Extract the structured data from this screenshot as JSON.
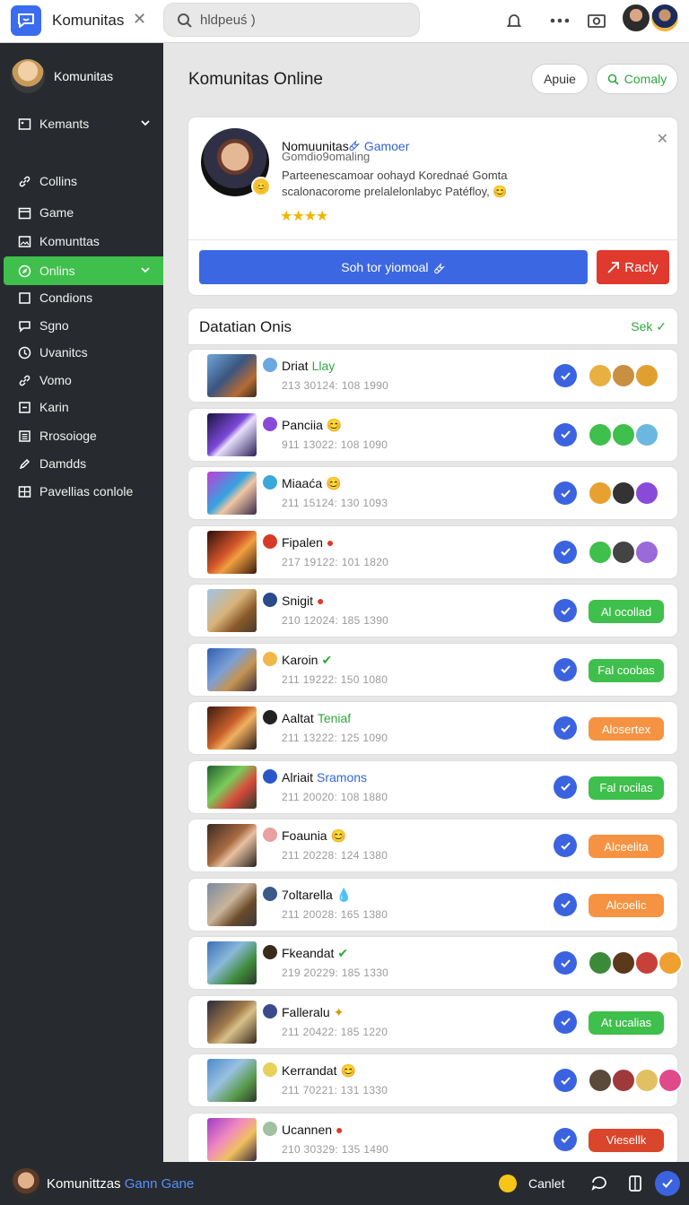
{
  "app": {
    "title": "Komunitas"
  },
  "search": {
    "value": "hldpeuś )"
  },
  "sidebar": {
    "profile_name": "Komunitas",
    "section_label": "Kemants",
    "items": [
      {
        "label": "Collins",
        "icon": "link-icon"
      },
      {
        "label": "Game",
        "icon": "calendar-icon"
      },
      {
        "label": "Komunttas",
        "icon": "image-icon"
      },
      {
        "label": "Onlins",
        "icon": "compass-icon",
        "active": true
      },
      {
        "label": "Condions",
        "icon": "square-icon"
      },
      {
        "label": "Sgno",
        "icon": "chat-icon"
      },
      {
        "label": "Uvanitcs",
        "icon": "clock-icon"
      },
      {
        "label": "Vomo",
        "icon": "link-icon"
      },
      {
        "label": "Karin",
        "icon": "minus-square-icon"
      },
      {
        "label": "Rrosoioge",
        "icon": "list-icon"
      },
      {
        "label": "Damdds",
        "icon": "pencil-icon"
      },
      {
        "label": "Pavellias conlole",
        "icon": "grid-icon"
      }
    ]
  },
  "main": {
    "title": "Komunitas Online",
    "btn_secondary": "Apuie",
    "btn_primary": "Comaly"
  },
  "hero": {
    "name": "Nomuunitas",
    "name_tag": "Gamoer",
    "subtitle": "Gomdio9omaling",
    "desc_line1": "Parteenescamoar oohayd Korednaé Gomta",
    "desc_line2": "scalonacorome prelalelonlabyc Patéfloy,",
    "stars": "★★★★",
    "primary_action": "Soh tor yiomoal",
    "secondary_action": "Racly"
  },
  "list": {
    "title": "Datatian Onis",
    "action": "Sek",
    "rows": [
      {
        "name": "Driat",
        "tag": "Llay",
        "tag_color": "#2fa83e",
        "meta": "213 30124: 108 1990",
        "pill": null,
        "pill_color": null
      },
      {
        "name": "Panciia",
        "tag": "😊",
        "tag_color": "#d49a00",
        "meta": "911 13022: 108 1090",
        "pill": null,
        "pill_color": null
      },
      {
        "name": "Miaaća",
        "tag": "😊",
        "tag_color": "#d49a00",
        "meta": "211 15124: 130 1093",
        "pill": null,
        "pill_color": null
      },
      {
        "name": "Fipalen",
        "tag": "●",
        "tag_color": "#e0392d",
        "meta": "217 19122: 101 1820",
        "pill": null,
        "pill_color": null
      },
      {
        "name": "Snigit",
        "tag": "●",
        "tag_color": "#e0392d",
        "meta": "210 12024: 185 1390",
        "pill": "Al ocollad",
        "pill_color": "#3fbf4b"
      },
      {
        "name": "Karoin",
        "tag": "✔",
        "tag_color": "#2fa83e",
        "meta": "211 19222: 150 1080",
        "pill": "Fal coobas",
        "pill_color": "#3fbf4b"
      },
      {
        "name": "Aaltat",
        "tag": "Teniaf",
        "tag_color": "#2fa83e",
        "meta": "211 13222: 125 1090",
        "pill": "Alosertex",
        "pill_color": "#f59342"
      },
      {
        "name": "Alriait",
        "tag": "Sramons",
        "tag_color": "#3264d8",
        "meta": "211 20020: 108 1880",
        "pill": "Fal rocilas",
        "pill_color": "#3fbf4b"
      },
      {
        "name": "Foaunia",
        "tag": "😊",
        "tag_color": "#d49a00",
        "meta": "211 20228: 124 1380",
        "pill": "Alceelita",
        "pill_color": "#f59342"
      },
      {
        "name": "7oltarella",
        "tag": "💧",
        "tag_color": "#3264d8",
        "meta": "211 20028: 165 1380",
        "pill": "Alcoelic",
        "pill_color": "#f59342"
      },
      {
        "name": "Fkeandat",
        "tag": "✔",
        "tag_color": "#2fa83e",
        "meta": "219 20229: 185 1330",
        "pill": null,
        "pill_color": null
      },
      {
        "name": "Falleralu",
        "tag": "✦",
        "tag_color": "#d49a00",
        "meta": "211 20422: 185 1220",
        "pill": "At ucalias",
        "pill_color": "#3fbf4b"
      },
      {
        "name": "Kerrandat",
        "tag": "😊",
        "tag_color": "#d49a00",
        "meta": "211 70221: 131 1330",
        "pill": null,
        "pill_color": null
      },
      {
        "name": "Ucannen",
        "tag": "●",
        "tag_color": "#e0392d",
        "meta": "210 30329: 135 1490",
        "pill": "Viesellk",
        "pill_color": "#d9462b"
      }
    ]
  },
  "footer": {
    "title": "Komunittzas",
    "title_tag": "Gann Gane",
    "label": "Canlet"
  }
}
